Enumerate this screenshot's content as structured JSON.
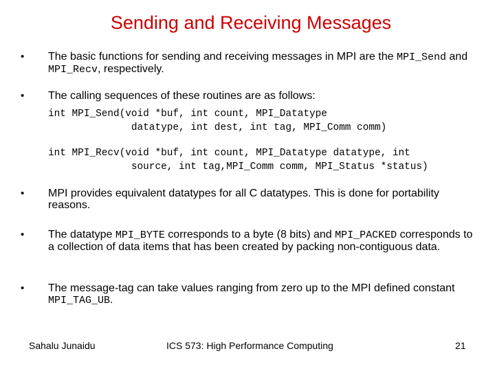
{
  "slide": {
    "title": "Sending and Receiving Messages",
    "title_color": "#cc0000",
    "bullet_glyph": "•",
    "bullets": [
      {
        "parts": [
          {
            "text": "The basic functions for sending and receiving messages in MPI are the ",
            "mono": false
          },
          {
            "text": "MPI_Send",
            "mono": true
          },
          {
            "text": " and ",
            "mono": false
          },
          {
            "text": "MPI_Recv",
            "mono": true
          },
          {
            "text": ", respectively.",
            "mono": false
          }
        ]
      },
      {
        "text": "The calling sequences of these routines are as follows:",
        "code_blocks": [
          {
            "lines": [
              "int MPI_Send(void *buf, int count, MPI_Datatype",
              "              datatype, int dest, int tag, MPI_Comm comm)"
            ]
          },
          {
            "lines": [
              "int MPI_Recv(void *buf, int count, MPI_Datatype datatype, int",
              "              source, int tag,MPI_Comm comm, MPI_Status *status)"
            ]
          }
        ]
      },
      {
        "text": "MPI provides equivalent datatypes for all C datatypes. This is done for portability reasons."
      },
      {
        "parts": [
          {
            "text": "The datatype ",
            "mono": false
          },
          {
            "text": "MPI_BYTE",
            "mono": true
          },
          {
            "text": " corresponds to a byte (8 bits) and ",
            "mono": false
          },
          {
            "text": "MPI_PACKED",
            "mono": true
          },
          {
            "text": " corresponds to a collection of data items that has been created by packing non-contiguous data.",
            "mono": false
          }
        ]
      },
      {
        "parts": [
          {
            "text": "The message-tag can take values ranging from zero up to the MPI defined constant ",
            "mono": false
          },
          {
            "text": "MPI_TAG_UB",
            "mono": true
          },
          {
            "text": ".",
            "mono": false
          }
        ]
      }
    ]
  },
  "footer": {
    "author": "Sahalu Junaidu",
    "course": "ICS 573: High Performance Computing",
    "page_number": "21"
  }
}
